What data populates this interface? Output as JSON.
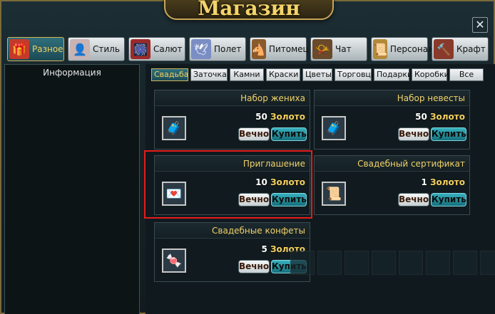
{
  "window": {
    "title": "Магазин",
    "close_label": "✕"
  },
  "categories": [
    {
      "label": "Разное",
      "icon": "gift-icon",
      "glyph": "🎁",
      "color": "#c43a2a",
      "active": true
    },
    {
      "label": "Стиль",
      "icon": "outfit-icon",
      "glyph": "👤",
      "color": "#c9b3b3",
      "active": false
    },
    {
      "label": "Салют",
      "icon": "firework-icon",
      "glyph": "🎆",
      "color": "#9b2a2a",
      "active": false
    },
    {
      "label": "Полет",
      "icon": "wings-icon",
      "glyph": "🕊",
      "color": "#7a8ec4",
      "active": false
    },
    {
      "label": "Питомец",
      "icon": "horse-icon",
      "glyph": "🐴",
      "color": "#8a5a2a",
      "active": false
    },
    {
      "label": "Чат",
      "icon": "horn-icon",
      "glyph": "📯",
      "color": "#6a4a2a",
      "active": false
    },
    {
      "label": "Персонаж",
      "icon": "scroll-icon",
      "glyph": "📜",
      "color": "#b38a3a",
      "active": false
    },
    {
      "label": "Крафт",
      "icon": "hammer-icon",
      "glyph": "🔨",
      "color": "#8a3a2a",
      "active": false
    }
  ],
  "info": {
    "title": "Информация"
  },
  "subtabs": [
    {
      "label": "Свадьба",
      "active": true
    },
    {
      "label": "Заточка",
      "active": false
    },
    {
      "label": "Камни",
      "active": false
    },
    {
      "label": "Краски",
      "active": false
    },
    {
      "label": "Цветы",
      "active": false
    },
    {
      "label": "Торговцы",
      "active": false
    },
    {
      "label": "Подарки",
      "active": false
    },
    {
      "label": "Коробки",
      "active": false
    },
    {
      "label": "Все",
      "active": false
    }
  ],
  "items": [
    {
      "name": "Набор жениха",
      "price": "50",
      "currency": "Золото",
      "forever_label": "Вечно",
      "buy_label": "Купить",
      "icon": "chest-icon",
      "glyph": "🧳"
    },
    {
      "name": "Набор невесты",
      "price": "50",
      "currency": "Золото",
      "forever_label": "Вечно",
      "buy_label": "Купить",
      "icon": "chest-icon",
      "glyph": "🧳"
    },
    {
      "name": "Приглашение",
      "price": "10",
      "currency": "Золото",
      "forever_label": "Вечно",
      "buy_label": "Купить",
      "icon": "invitation-icon",
      "glyph": "💌"
    },
    {
      "name": "Свадебный сертификат",
      "price": "1",
      "currency": "Золото",
      "forever_label": "Вечно",
      "buy_label": "Купить",
      "icon": "certificate-icon",
      "glyph": "📜"
    },
    {
      "name": "Свадебные конфеты",
      "price": "5",
      "currency": "Золото",
      "forever_label": "Вечно",
      "buy_label": "Купить",
      "icon": "candy-icon",
      "glyph": "🍬"
    }
  ]
}
